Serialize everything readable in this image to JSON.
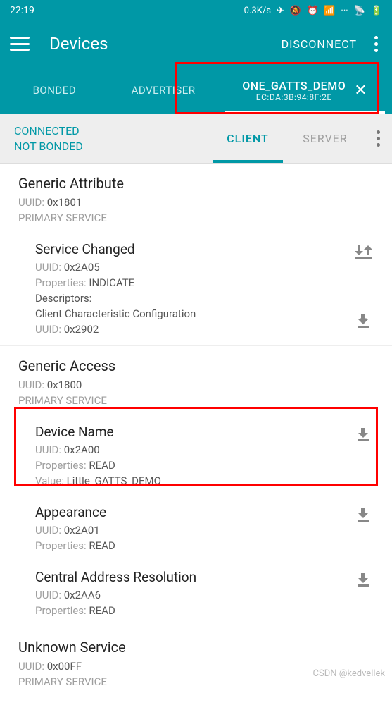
{
  "status": {
    "time": "22:19",
    "net": "0.3K/s"
  },
  "header": {
    "title": "Devices",
    "action": "DISCONNECT"
  },
  "tabs": {
    "bonded": "BONDED",
    "advertiser": "ADVERTISER",
    "device_name": "ONE_GATTS_DEMO",
    "device_mac": "EC:DA:3B:94:8F:2E"
  },
  "conn": {
    "line1": "CONNECTED",
    "line2": "NOT BONDED"
  },
  "subtabs": {
    "client": "CLIENT",
    "server": "SERVER"
  },
  "labels": {
    "uuid": "UUID:",
    "primary": "PRIMARY SERVICE",
    "properties": "Properties:",
    "descriptors": "Descriptors:",
    "value": "Value:"
  },
  "services": {
    "ga": {
      "name": "Generic Attribute",
      "uuid": "0x1801"
    },
    "sc": {
      "name": "Service Changed",
      "uuid": "0x2A05",
      "props": "INDICATE",
      "desc_name": "Client Characteristic Configuration",
      "desc_uuid": "0x2902"
    },
    "gacc": {
      "name": "Generic Access",
      "uuid": "0x1800"
    },
    "dn": {
      "name": "Device Name",
      "uuid": "0x2A00",
      "props": "READ",
      "value": "Little_GATTS_DEMO"
    },
    "ap": {
      "name": "Appearance",
      "uuid": "0x2A01",
      "props": "READ"
    },
    "car": {
      "name": "Central Address Resolution",
      "uuid": "0x2AA6",
      "props": "READ"
    },
    "unk": {
      "name": "Unknown Service",
      "uuid": "0x00FF"
    }
  },
  "watermark": "CSDN @kedvellek"
}
